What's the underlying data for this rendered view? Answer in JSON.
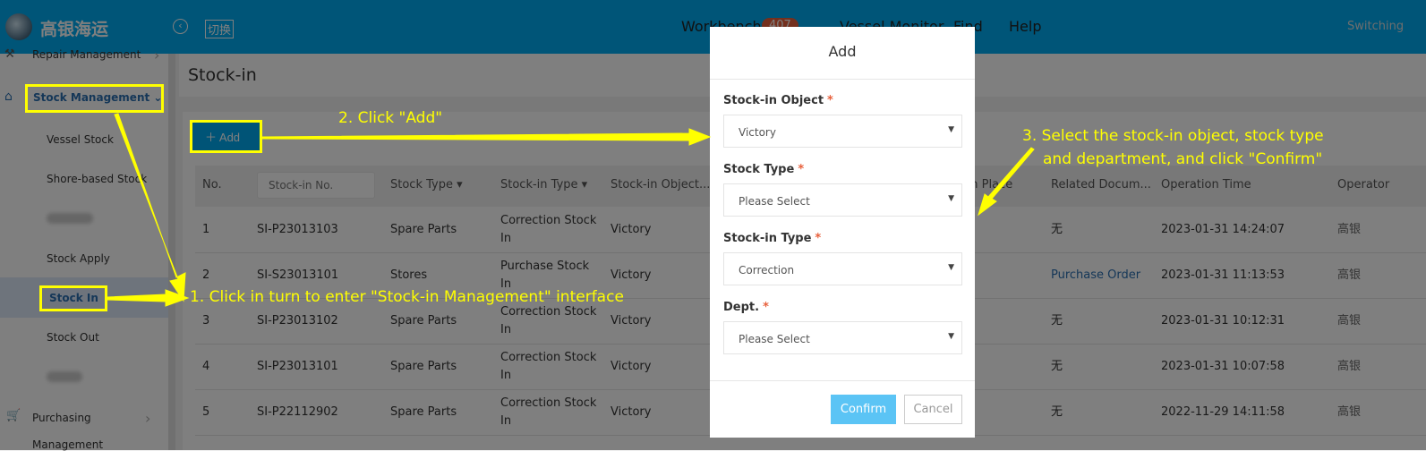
{
  "header": {
    "logo_text": "高银海运",
    "switch_label": "切换",
    "nav": [
      {
        "label": "Workbench",
        "badge": "407"
      },
      {
        "label": "Vessel Monitor"
      },
      {
        "label": "Find"
      },
      {
        "label": "Help"
      }
    ],
    "switching": "Switching"
  },
  "sidebar": {
    "items": [
      {
        "label": "Repair Management"
      },
      {
        "label": "Stock Management"
      },
      {
        "label": "Vessel Stock"
      },
      {
        "label": "Shore-based Stock"
      },
      {
        "label": "Stock Apply"
      },
      {
        "label": "Stock In"
      },
      {
        "label": "Stock Out"
      },
      {
        "label": "Purchasing"
      },
      {
        "label": "Management"
      }
    ]
  },
  "main": {
    "title": "Stock-in",
    "add_label": "Add",
    "search_placeholder": "Stock-in No.",
    "columns": [
      "No.",
      "Stock Type",
      "Stock-in Type",
      "Stock-in Object...",
      "Stock-in Place",
      "Related Docum...",
      "Operation Time",
      "Operator"
    ],
    "rows": [
      {
        "no": "1",
        "sino": "SI-P23013103",
        "stype": "Spare Parts",
        "sitype": "Correction Stock In",
        "obj": "Victory",
        "doc": "无",
        "time": "2023-01-31 14:24:07",
        "op": "高银"
      },
      {
        "no": "2",
        "sino": "SI-S23013101",
        "stype": "Stores",
        "sitype": "Purchase Stock In",
        "obj": "Victory",
        "doc": "Purchase Order",
        "time": "2023-01-31 11:13:53",
        "op": "高银"
      },
      {
        "no": "3",
        "sino": "SI-P23013102",
        "stype": "Spare Parts",
        "sitype": "Correction Stock In",
        "obj": "Victory",
        "doc": "无",
        "time": "2023-01-31 10:12:31",
        "op": "高银"
      },
      {
        "no": "4",
        "sino": "SI-P23013101",
        "stype": "Spare Parts",
        "sitype": "Correction Stock In",
        "obj": "Victory",
        "doc": "无",
        "time": "2023-01-31 10:07:58",
        "op": "高银"
      },
      {
        "no": "5",
        "sino": "SI-P22112902",
        "stype": "Spare Parts",
        "sitype": "Correction Stock In",
        "obj": "Victory",
        "doc": "无",
        "time": "2022-11-29 14:11:58",
        "op": "高银"
      }
    ]
  },
  "modal": {
    "title": "Add",
    "fields": [
      {
        "label": "Stock-in Object",
        "value": "Victory"
      },
      {
        "label": "Stock Type",
        "value": "Please Select"
      },
      {
        "label": "Stock-in Type",
        "value": "Correction"
      },
      {
        "label": "Dept.",
        "value": "Please Select"
      }
    ],
    "required_mark": "*",
    "confirm": "Confirm",
    "cancel": "Cancel"
  },
  "annotations": {
    "step1": "1. Click in turn to enter \"Stock-in Management\" interface",
    "step2": "2. Click \"Add\"",
    "step3_line1": "3. Select the stock-in object, stock type",
    "step3_line2": "and department, and click \"Confirm\""
  },
  "colors": {
    "header": "#00aaf0",
    "annotation": "#ffff00",
    "confirm": "#5bc4f5",
    "required": "#e8603c"
  }
}
